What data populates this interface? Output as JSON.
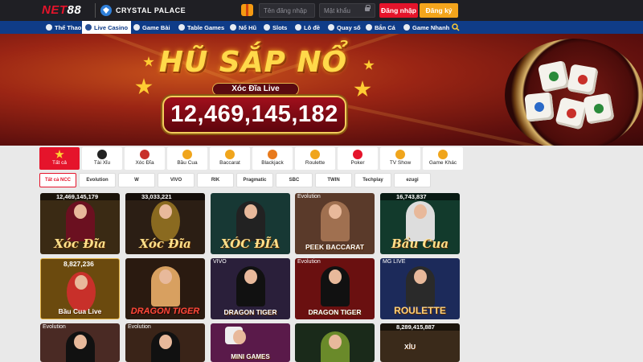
{
  "header": {
    "logo": "NET88",
    "partner": "CRYSTAL PALACE",
    "username_placeholder": "Tên đăng nhập",
    "password_placeholder": "Mật khẩu",
    "login_label": "Đăng nhập",
    "register_label": "Đăng ký"
  },
  "nav": {
    "items": [
      {
        "label": "Thể Thao",
        "icon": "soccer-icon"
      },
      {
        "label": "Live Casino",
        "icon": "casino-icon",
        "active": true
      },
      {
        "label": "Game Bài",
        "icon": "cards-icon"
      },
      {
        "label": "Table Games",
        "icon": "table-icon"
      },
      {
        "label": "Nổ Hũ",
        "icon": "jackpot-icon"
      },
      {
        "label": "Slots",
        "icon": "slot-icon"
      },
      {
        "label": "Lô đề",
        "icon": "lottery-icon"
      },
      {
        "label": "Quay số",
        "icon": "wheel-icon"
      },
      {
        "label": "Bắn Cá",
        "icon": "fish-icon"
      },
      {
        "label": "Game Nhanh",
        "icon": "flash-icon"
      }
    ]
  },
  "banner": {
    "title": "HŨ SẮP NỔ",
    "game": "Xóc Đĩa Live",
    "jackpot": "12,469,145,182"
  },
  "categories": [
    {
      "label": "Tất cả",
      "active": true
    },
    {
      "label": "Tài Xỉu"
    },
    {
      "label": "Xóc Đĩa"
    },
    {
      "label": "Bầu Cua"
    },
    {
      "label": "Baccarat"
    },
    {
      "label": "Blackjack"
    },
    {
      "label": "Roulette"
    },
    {
      "label": "Poker"
    },
    {
      "label": "TV Show"
    },
    {
      "label": "Game Khác"
    }
  ],
  "providers": [
    {
      "label": "Tất cả NCC",
      "active": true
    },
    {
      "label": "Evolution"
    },
    {
      "label": "W"
    },
    {
      "label": "VIVO"
    },
    {
      "label": "RIK"
    },
    {
      "label": "Pragmatic"
    },
    {
      "label": "SBC"
    },
    {
      "label": "TWIN"
    },
    {
      "label": "Techplay"
    },
    {
      "label": "ezugi"
    }
  ],
  "games": [
    {
      "amount": "12,469,145,179",
      "name": "Xóc Đĩa",
      "style": "big",
      "bg": "#3a2a14"
    },
    {
      "amount": "33,033,221",
      "name": "Xóc Đĩa",
      "style": "big",
      "bg": "#2b1e14"
    },
    {
      "amount": "",
      "name": "XÓC ĐĨA",
      "style": "big",
      "bg": "#173834"
    },
    {
      "amount": "",
      "provider": "Evolution",
      "name": "PEEK BACCARAT",
      "style": "small",
      "bg": "#5a3a2a"
    },
    {
      "amount": "16,743,837",
      "name": "Bầu Cua",
      "style": "big",
      "bg": "#123a2c"
    },
    {
      "amount": "8,827,236",
      "name": "Bầu Cua Live",
      "style": "small",
      "bg": "#6b4a0e"
    },
    {
      "amount": "",
      "name": "DRAGON TIGER",
      "style": "red",
      "bg": "#2a1a10"
    },
    {
      "amount": "",
      "provider": "VIVO",
      "name": "DRAGON TIGER",
      "style": "small",
      "bg": "#2a1f3a"
    },
    {
      "amount": "",
      "provider": "Evolution",
      "name": "DRAGON TIGER",
      "style": "small",
      "bg": "#6a1010"
    },
    {
      "amount": "",
      "provider": "MG LIVE",
      "name": "ROULETTE",
      "style": "gold",
      "bg": "#1c2a5a"
    },
    {
      "amount": "",
      "provider": "Evolution",
      "name": "",
      "style": "small",
      "bg": "#4a2a24"
    },
    {
      "amount": "",
      "provider": "Evolution",
      "name": "",
      "style": "small",
      "bg": "#3a2418"
    },
    {
      "amount": "",
      "name": "MINI GAMES",
      "style": "small",
      "bg": "#5a1a4a"
    },
    {
      "amount": "",
      "name": "",
      "style": "small",
      "bg": "#1a2a1a"
    },
    {
      "amount": "8,289,415,887",
      "name": "XỈU",
      "style": "small",
      "bg": "#3a2a1a"
    }
  ]
}
